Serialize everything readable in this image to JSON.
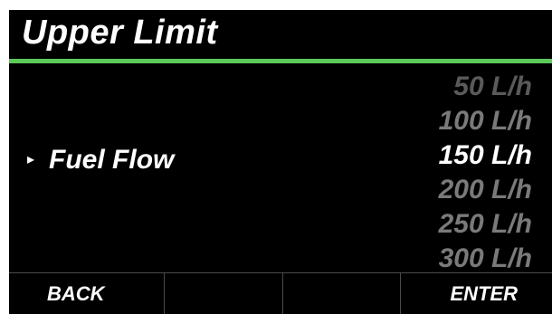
{
  "header": {
    "title": "Upper Limit",
    "accent_color": "#5cc85a"
  },
  "setting": {
    "pointer_icon": "right-triangle-icon",
    "pointer_glyph": "▸",
    "label": "Fuel Flow"
  },
  "picker": {
    "options": [
      "50 L/h",
      "100 L/h",
      "150 L/h",
      "200 L/h",
      "250 L/h",
      "300 L/h"
    ],
    "selected": "150 L/h"
  },
  "softkeys": {
    "back_label": "BACK",
    "key2_label": "",
    "key3_label": "",
    "enter_label": "ENTER"
  }
}
